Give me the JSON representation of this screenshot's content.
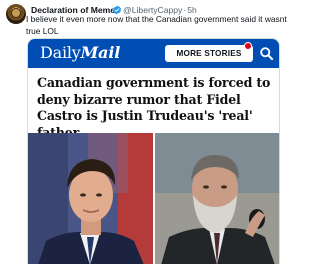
{
  "tweet": {
    "display_name": "Declaration of Memes",
    "verified_color": "#1d9bf0",
    "handle": "@LibertyCappy",
    "separator": "·",
    "time": "5h",
    "text": "I believe it even more now that the Canadian government said it wasnt true LOL"
  },
  "card": {
    "brand_prefix": "Daily",
    "brand_suffix": "Mail",
    "brand_color": "#004db3",
    "more_button_label": "MORE STORIES",
    "notification_color": "#e1001a",
    "search_icon": "search-icon",
    "headline": "Canadian government is forced to deny bizarre rumor that Fidel Castro is Justin Trudeau's 'real' father"
  }
}
